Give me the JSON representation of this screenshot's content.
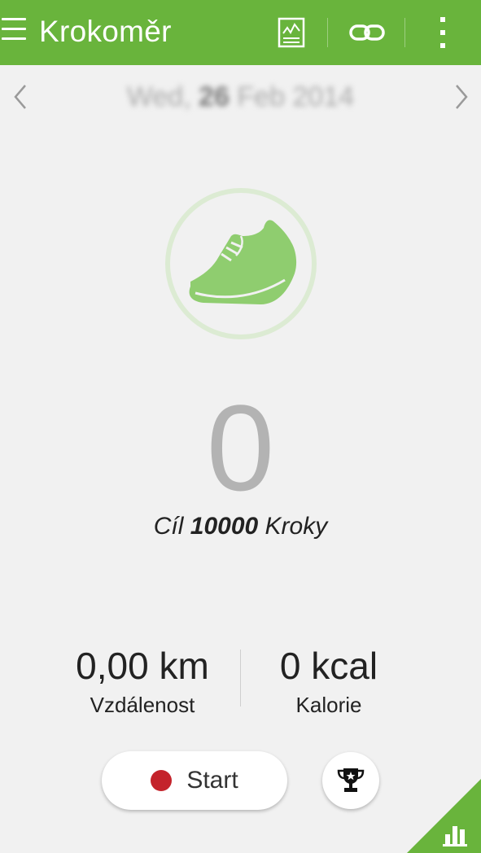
{
  "app": {
    "title": "Krokoměr"
  },
  "actionbar": {
    "icons": [
      "menu-icon",
      "report-icon",
      "link-icon",
      "more-vert-icon"
    ]
  },
  "date": {
    "weekday": "Wed,",
    "day": "26",
    "month_year": "Feb 2014"
  },
  "steps": {
    "count": "0",
    "goal_prefix": "Cíl",
    "goal_value": "10000",
    "goal_suffix": "Kroky"
  },
  "stats": {
    "distance_value": "0,00 km",
    "distance_label": "Vzdálenost",
    "calories_value": "0 kcal",
    "calories_label": "Kalorie"
  },
  "controls": {
    "start_label": "Start"
  },
  "colors": {
    "accent": "#69b43c",
    "shoe": "#8fcd6f",
    "ring": "#dcebd3",
    "record": "#c4232b"
  }
}
